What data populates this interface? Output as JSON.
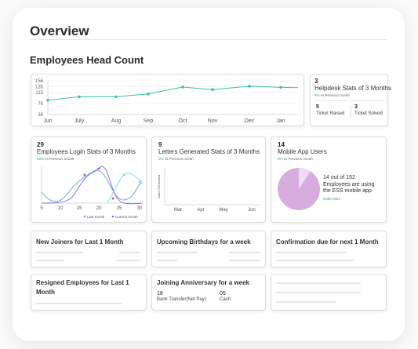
{
  "page_title": "Overview",
  "headcount": {
    "title": "Employees Head Count",
    "y_ticks": [
      "156",
      "135",
      "115",
      "76",
      "38"
    ],
    "x_labels": [
      "Jun",
      "July",
      "Aug",
      "Sep",
      "Oct",
      "Nov",
      "Dec",
      "Jan"
    ],
    "values": [
      88,
      100,
      100,
      110,
      134,
      125,
      137,
      133
    ]
  },
  "helpdesk": {
    "count": "3",
    "title": "Helpdesk Stats of 3 Months",
    "change_pct": "0%",
    "change_text": "vs Previous month",
    "raised_count": "5",
    "raised_label": "Ticket Raised",
    "solved_count": "3",
    "solved_label": "Ticket Solved"
  },
  "login": {
    "count": "29",
    "title": "Employees Login Stats of 3 Months",
    "change_pct": "53%",
    "change_text": "vs Previous month",
    "x_ticks": [
      "5",
      "10",
      "15",
      "20",
      "25",
      "30"
    ],
    "legend_last": "Last month",
    "legend_current": "Current month",
    "colors": {
      "last": "#5aa4e8",
      "current": "#8e63d6",
      "aqua": "#7fdcd2"
    }
  },
  "letters": {
    "count": "9",
    "title": "Letters Generated Stats of 3 Months",
    "change_pct": "0%",
    "change_text": "vs Previous month",
    "y_label": "Letter Generated",
    "x_ticks": [
      "Mar",
      "Apr",
      "May",
      "Jun"
    ]
  },
  "mobile": {
    "count": "14",
    "title": "Mobile App Users",
    "change_pct": "0%",
    "change_text": "vs Previous month",
    "summary_line1": "14 out of 152",
    "summary_line2": "Employees are using",
    "summary_line3": "the ESS mobile app",
    "invite_label": "Invite More",
    "pie": {
      "using": 14,
      "total": 152,
      "colors": {
        "main": "#d7ade0",
        "slice": "#efdcf3"
      }
    }
  },
  "boxes": {
    "new_joiners": "New Joiners for Last 1 Month",
    "birthdays": "Upcoming Birthdays for a week",
    "confirmation": "Confirmation due for next 1 Month",
    "resigned": "Resigned Employees for Last 1 Month",
    "anniversary": "Joining Anniversary for a week",
    "bank_count": "18",
    "bank_label": "Bank Transfer(Net Pay)",
    "cash_count": "05",
    "cash_label": "Cash"
  },
  "colors": {
    "accent": "#3dbfa6",
    "green": "#2ea84a"
  }
}
